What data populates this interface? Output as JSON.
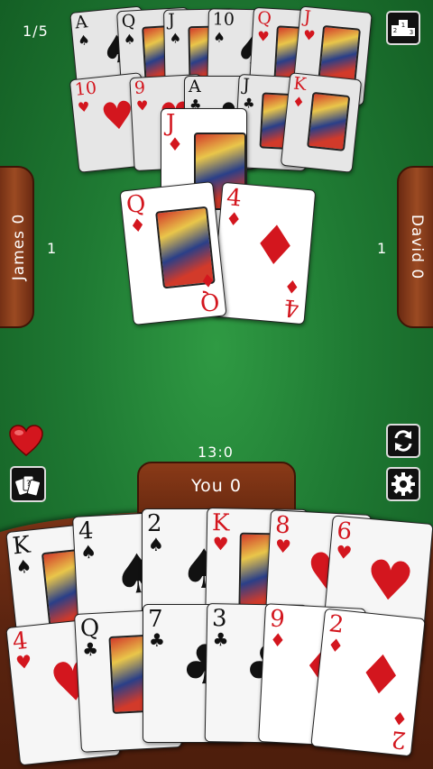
{
  "hud": {
    "round": "1/5",
    "score": "13:0",
    "players": {
      "left": {
        "name": "James 0",
        "count": "1"
      },
      "right": {
        "name": "David 0",
        "count": "1"
      },
      "bottom": {
        "name": "You 0"
      }
    }
  },
  "icons": {
    "leaderboard": "podium-icon",
    "swap": "swap-arrows-icon",
    "settings": "gear-icon",
    "heart": "heart-icon",
    "cards": "cards-icon"
  },
  "colors": {
    "table": "#1f7a33",
    "wood": "#5b2410",
    "red": "#d3161e",
    "black": "#111111"
  },
  "top_hand": {
    "row1": [
      {
        "rank": "A",
        "suit": "♠"
      },
      {
        "rank": "Q",
        "suit": "♠"
      },
      {
        "rank": "J",
        "suit": "♠"
      },
      {
        "rank": "10",
        "suit": "♠"
      },
      {
        "rank": "Q",
        "suit": "♥"
      },
      {
        "rank": "J",
        "suit": "♥"
      }
    ],
    "row2": [
      {
        "rank": "10",
        "suit": "♥"
      },
      {
        "rank": "9",
        "suit": "♥"
      },
      {
        "rank": "A",
        "suit": "♣"
      },
      {
        "rank": "J",
        "suit": "♣"
      },
      {
        "rank": "K",
        "suit": "♦"
      }
    ]
  },
  "trick": [
    {
      "rank": "J",
      "suit": "♦"
    },
    {
      "rank": "4",
      "suit": "♦"
    },
    {
      "rank": "Q",
      "suit": "♦"
    }
  ],
  "my_hand": {
    "row1": [
      {
        "rank": "K",
        "suit": "♠"
      },
      {
        "rank": "4",
        "suit": "♠"
      },
      {
        "rank": "2",
        "suit": "♠"
      },
      {
        "rank": "K",
        "suit": "♥"
      },
      {
        "rank": "8",
        "suit": "♥"
      },
      {
        "rank": "6",
        "suit": "♥"
      }
    ],
    "row2": [
      {
        "rank": "4",
        "suit": "♥"
      },
      {
        "rank": "Q",
        "suit": "♣"
      },
      {
        "rank": "7",
        "suit": "♣"
      },
      {
        "rank": "3",
        "suit": "♣"
      },
      {
        "rank": "9",
        "suit": "♦"
      },
      {
        "rank": "2",
        "suit": "♦"
      }
    ]
  }
}
